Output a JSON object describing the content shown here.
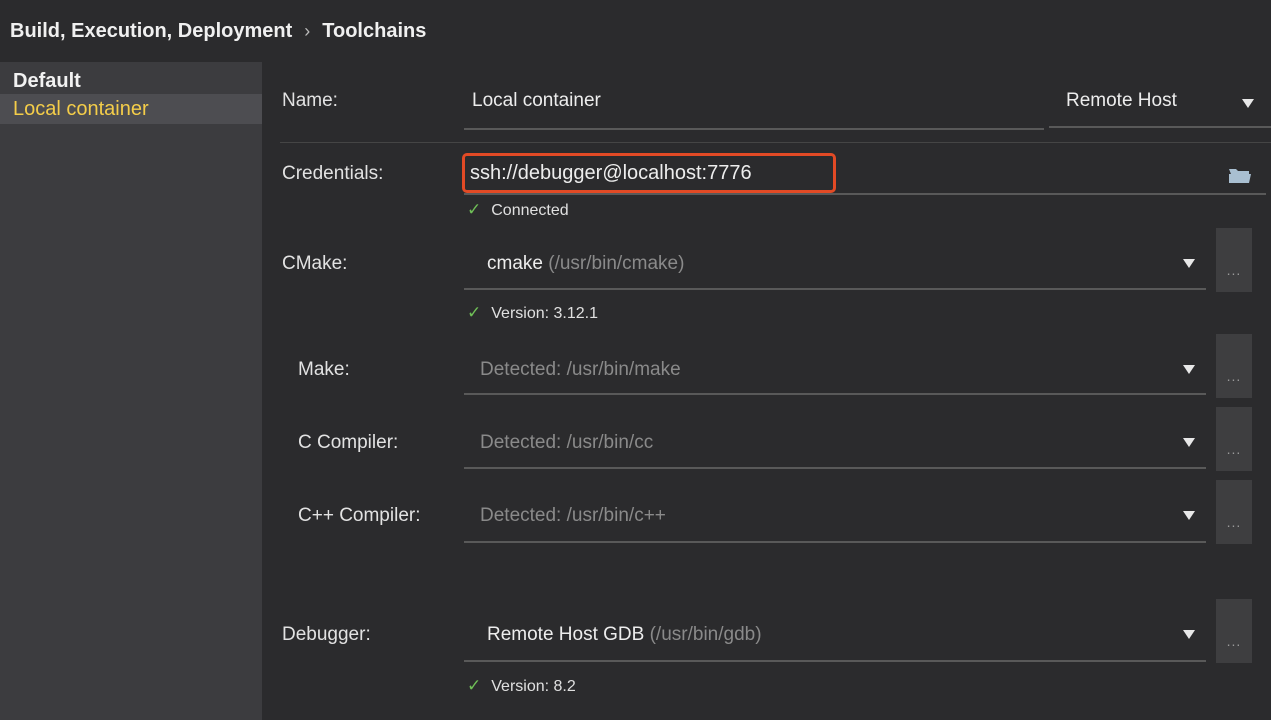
{
  "breadcrumb": {
    "parent": "Build, Execution, Deployment",
    "separator": "›",
    "current": "Toolchains"
  },
  "sidebar": {
    "group": "Default",
    "items": [
      {
        "label": "Local container",
        "selected": true
      }
    ]
  },
  "form": {
    "name": {
      "label": "Name:",
      "value": "Local container"
    },
    "type_select": {
      "value": "Remote Host"
    },
    "credentials": {
      "label": "Credentials:",
      "value": "ssh://debugger@localhost:7776",
      "status": "Connected",
      "highlight_color": "#e24a25"
    },
    "cmake": {
      "label": "CMake:",
      "value": "cmake",
      "path": "(/usr/bin/cmake)",
      "status": "Version: 3.12.1"
    },
    "make": {
      "label": "Make:",
      "placeholder": "Detected: /usr/bin/make"
    },
    "c_compiler": {
      "label": "C Compiler:",
      "placeholder": "Detected: /usr/bin/cc"
    },
    "cpp_compiler": {
      "label": "C++ Compiler:",
      "placeholder": "Detected: /usr/bin/c++"
    },
    "debugger": {
      "label": "Debugger:",
      "value": "Remote Host GDB",
      "path": "(/usr/bin/gdb)",
      "status": "Version: 8.2"
    },
    "ellipsis": "...",
    "icons": {
      "check": "check-icon",
      "caret": "chevron-down-icon",
      "folder": "folder-open-icon"
    },
    "colors": {
      "selected_text": "#f4cd49",
      "check": "#6fbf57"
    }
  }
}
